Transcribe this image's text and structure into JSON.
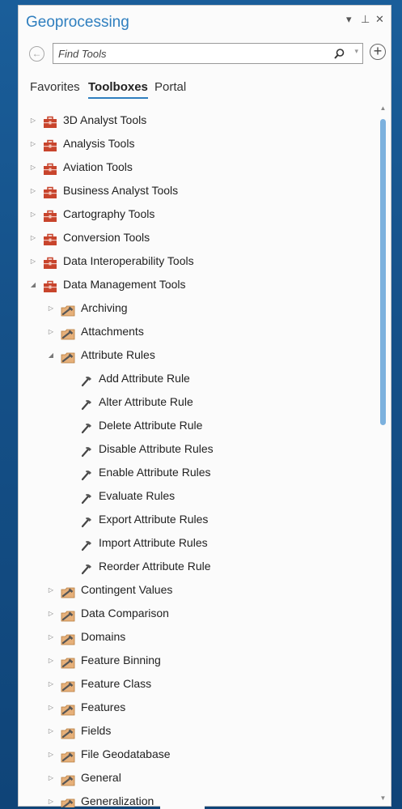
{
  "pane": {
    "title": "Geoprocessing",
    "controls": {
      "dropdown": "▾",
      "pin": "⊥",
      "close": "✕"
    }
  },
  "search": {
    "placeholder": "Find Tools",
    "value": ""
  },
  "tabs": [
    {
      "label": "Favorites",
      "active": false
    },
    {
      "label": "Toolboxes",
      "active": true
    },
    {
      "label": "Portal",
      "active": false
    }
  ],
  "tree": [
    {
      "label": "3D Analyst Tools",
      "level": 0,
      "kind": "toolbox",
      "expanded": false
    },
    {
      "label": "Analysis Tools",
      "level": 0,
      "kind": "toolbox",
      "expanded": false
    },
    {
      "label": "Aviation Tools",
      "level": 0,
      "kind": "toolbox",
      "expanded": false
    },
    {
      "label": "Business Analyst Tools",
      "level": 0,
      "kind": "toolbox",
      "expanded": false
    },
    {
      "label": "Cartography Tools",
      "level": 0,
      "kind": "toolbox",
      "expanded": false
    },
    {
      "label": "Conversion Tools",
      "level": 0,
      "kind": "toolbox",
      "expanded": false
    },
    {
      "label": "Data Interoperability Tools",
      "level": 0,
      "kind": "toolbox",
      "expanded": false
    },
    {
      "label": "Data Management Tools",
      "level": 0,
      "kind": "toolbox",
      "expanded": true
    },
    {
      "label": "Archiving",
      "level": 1,
      "kind": "toolset",
      "expanded": false
    },
    {
      "label": "Attachments",
      "level": 1,
      "kind": "toolset",
      "expanded": false
    },
    {
      "label": "Attribute Rules",
      "level": 1,
      "kind": "toolset",
      "expanded": true
    },
    {
      "label": "Add Attribute Rule",
      "level": 2,
      "kind": "tool"
    },
    {
      "label": "Alter Attribute Rule",
      "level": 2,
      "kind": "tool"
    },
    {
      "label": "Delete Attribute Rule",
      "level": 2,
      "kind": "tool"
    },
    {
      "label": "Disable Attribute Rules",
      "level": 2,
      "kind": "tool"
    },
    {
      "label": "Enable Attribute Rules",
      "level": 2,
      "kind": "tool"
    },
    {
      "label": "Evaluate Rules",
      "level": 2,
      "kind": "tool"
    },
    {
      "label": "Export Attribute Rules",
      "level": 2,
      "kind": "tool"
    },
    {
      "label": "Import Attribute Rules",
      "level": 2,
      "kind": "tool"
    },
    {
      "label": "Reorder Attribute Rule",
      "level": 2,
      "kind": "tool"
    },
    {
      "label": "Contingent Values",
      "level": 1,
      "kind": "toolset",
      "expanded": false
    },
    {
      "label": "Data Comparison",
      "level": 1,
      "kind": "toolset",
      "expanded": false
    },
    {
      "label": "Domains",
      "level": 1,
      "kind": "toolset",
      "expanded": false
    },
    {
      "label": "Feature Binning",
      "level": 1,
      "kind": "toolset",
      "expanded": false
    },
    {
      "label": "Feature Class",
      "level": 1,
      "kind": "toolset",
      "expanded": false
    },
    {
      "label": "Features",
      "level": 1,
      "kind": "toolset",
      "expanded": false
    },
    {
      "label": "Fields",
      "level": 1,
      "kind": "toolset",
      "expanded": false
    },
    {
      "label": "File Geodatabase",
      "level": 1,
      "kind": "toolset",
      "expanded": false
    },
    {
      "label": "General",
      "level": 1,
      "kind": "toolset",
      "expanded": false
    },
    {
      "label": "Generalization",
      "level": 1,
      "kind": "toolset",
      "expanded": false
    }
  ],
  "colors": {
    "accent": "#2f7fbf",
    "toolbox_red": "#c8442c",
    "scroll_thumb": "#7cb1de",
    "background": "#1b5a93"
  }
}
